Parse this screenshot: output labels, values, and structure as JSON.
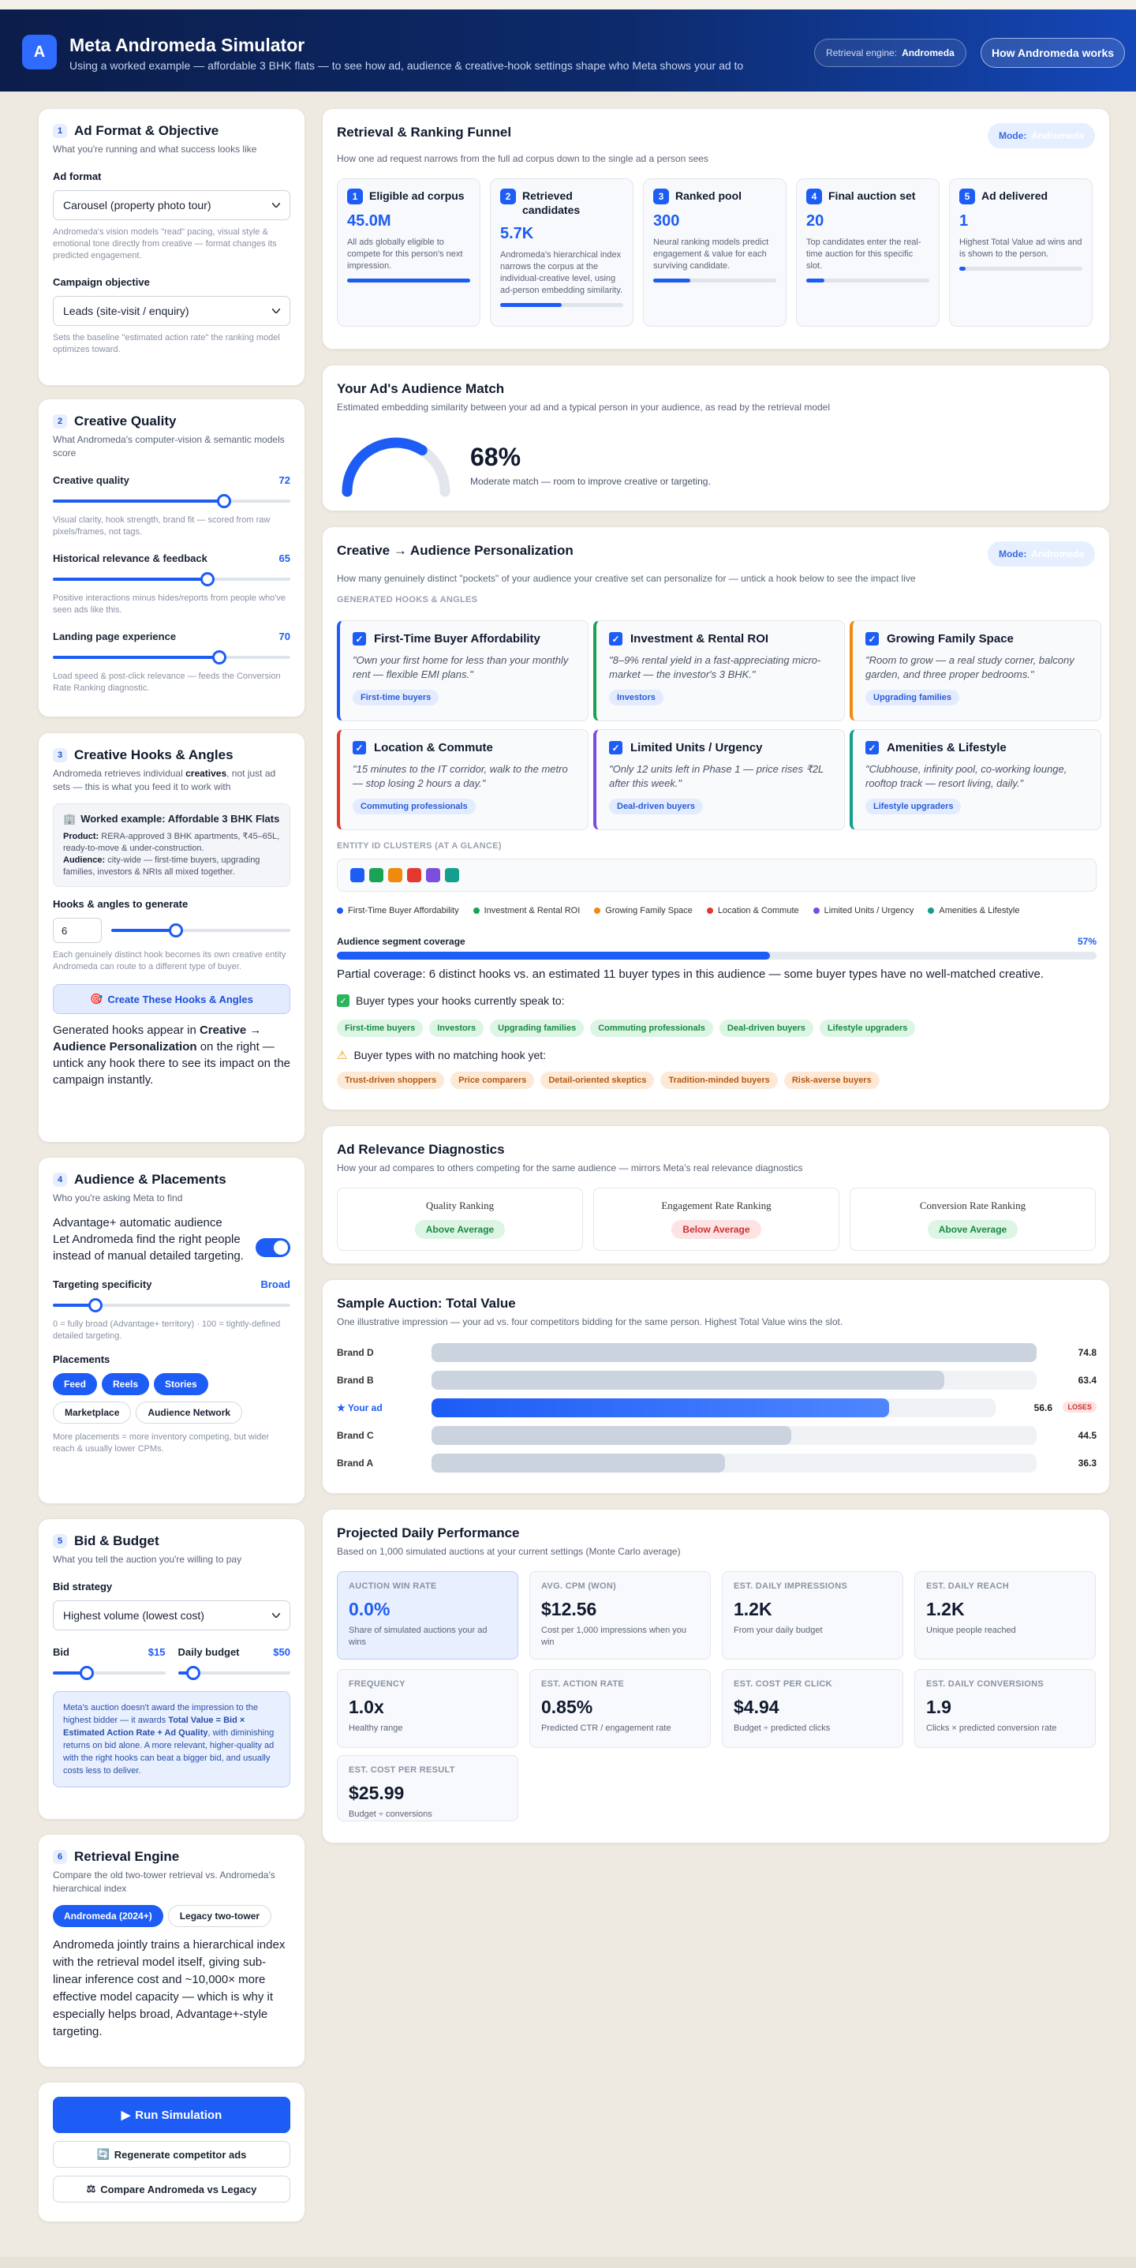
{
  "header": {
    "logo": "A",
    "title": "Meta Andromeda Simulator",
    "subtitle": "Using a worked example — affordable 3 BHK flats — to see how ad, audience & creative-hook settings shape who Meta shows your ad to",
    "engine_label": "Retrieval engine:",
    "engine_value": "Andromeda",
    "how_button": "How Andromeda works"
  },
  "s1": {
    "num": "1",
    "title": "Ad Format & Objective",
    "sub": "What you're running and what success looks like",
    "format_label": "Ad format",
    "format_value": "Carousel (property photo tour)",
    "format_hint": "Andromeda's vision models \"read\" pacing, visual style & emotional tone directly from creative — format changes its predicted engagement.",
    "obj_label": "Campaign objective",
    "obj_value": "Leads (site-visit / enquiry)",
    "obj_hint": "Sets the baseline \"estimated action rate\" the ranking model optimizes toward."
  },
  "s2": {
    "num": "2",
    "title": "Creative Quality",
    "sub": "What Andromeda's computer-vision & semantic models score",
    "cq_label": "Creative quality",
    "cq_value": "72",
    "cq_hint": "Visual clarity, hook strength, brand fit — scored from raw pixels/frames, not tags.",
    "hr_label": "Historical relevance & feedback",
    "hr_value": "65",
    "hr_hint": "Positive interactions minus hides/reports from people who've seen ads like this.",
    "lp_label": "Landing page experience",
    "lp_value": "70",
    "lp_hint": "Load speed & post-click relevance — feeds the Conversion Rate Ranking diagnostic."
  },
  "s3": {
    "num": "3",
    "title": "Creative Hooks & Angles",
    "sub_a": "Andromeda retrieves individual ",
    "sub_b": "creatives",
    "sub_c": ", not just ad sets — this is what you feed it to work with",
    "ex_title": "Worked example: Affordable 3 BHK Flats",
    "ex_prod_label": "Product:",
    "ex_prod": "RERA-approved 3 BHK apartments, ₹45–65L, ready-to-move & under-construction.",
    "ex_aud_label": "Audience:",
    "ex_aud": "city-wide — first-time buyers, upgrading families, investors & NRIs all mixed together.",
    "gen_label": "Hooks & angles to generate",
    "gen_value": "6",
    "gen_hint": "Each genuinely distinct hook becomes its own creative entity Andromeda can route to a different type of buyer.",
    "create_btn": "Create These Hooks & Angles",
    "note_a": "Generated hooks appear in ",
    "note_b": "Creative → Audience Personalization",
    "note_c": " on the right — untick any hook there to see its impact on the campaign instantly."
  },
  "s4": {
    "num": "4",
    "title": "Audience & Placements",
    "sub": "Who you're asking Meta to find",
    "adv_title": "Advantage+ automatic audience",
    "adv_desc": "Let Andromeda find the right people instead of manual detailed targeting.",
    "spec_label": "Targeting specificity",
    "spec_value": "Broad",
    "spec_hint": "0 = fully broad (Advantage+ territory) · 100 = tightly-defined detailed targeting.",
    "place_label": "Placements",
    "placements": [
      {
        "label": "Feed",
        "on": true
      },
      {
        "label": "Reels",
        "on": true
      },
      {
        "label": "Stories",
        "on": true
      },
      {
        "label": "Marketplace",
        "on": false
      },
      {
        "label": "Audience Network",
        "on": false
      }
    ],
    "place_hint": "More placements = more inventory competing, but wider reach & usually lower CPMs."
  },
  "s5": {
    "num": "5",
    "title": "Bid & Budget",
    "sub": "What you tell the auction you're willing to pay",
    "strat_label": "Bid strategy",
    "strat_value": "Highest volume (lowest cost)",
    "bid_label": "Bid",
    "bid_value": "$15",
    "budget_label": "Daily budget",
    "budget_value": "$50",
    "info_a": "Meta's auction doesn't award the impression to the highest bidder — it awards ",
    "info_b": "Total Value = Bid × Estimated Action Rate + Ad Quality",
    "info_c": ", with diminishing returns on bid alone. A more relevant, higher-quality ad with the right hooks can beat a bigger bid, and usually costs less to deliver."
  },
  "s6": {
    "num": "6",
    "title": "Retrieval Engine",
    "sub": "Compare the old two-tower retrieval vs. Andromeda's hierarchical index",
    "opt_on": "Andromeda (2024+)",
    "opt_off": "Legacy two-tower",
    "desc": "Andromeda jointly trains a hierarchical index with the retrieval model itself, giving sub-linear inference cost and ~10,000× more effective model capacity — which is why it especially helps broad, Advantage+-style targeting."
  },
  "actions": {
    "run": "Run Simulation",
    "regen": "Regenerate competitor ads",
    "compare": "Compare Andromeda vs Legacy"
  },
  "funnel": {
    "title": "Retrieval & Ranking Funnel",
    "sub": "How one ad request narrows from the full ad corpus down to the single ad a person sees",
    "mode_label": "Mode:",
    "mode_value": "Andromeda",
    "steps": [
      {
        "n": "1",
        "t": "Eligible ad corpus",
        "v": "45.0M",
        "d": "All ads globally eligible to compete for this person's next impression.",
        "p": 1.0
      },
      {
        "n": "2",
        "t": "Retrieved candidates",
        "v": "5.7K",
        "d": "Andromeda's hierarchical index narrows the corpus at the individual-creative level, using ad-person embedding similarity.",
        "p": 0.5
      },
      {
        "n": "3",
        "t": "Ranked pool",
        "v": "300",
        "d": "Neural ranking models predict engagement & value for each surviving candidate.",
        "p": 0.3
      },
      {
        "n": "4",
        "t": "Final auction set",
        "v": "20",
        "d": "Top candidates enter the real-time auction for this specific slot.",
        "p": 0.15
      },
      {
        "n": "5",
        "t": "Ad delivered",
        "v": "1",
        "d": "Highest Total Value ad wins and is shown to the person.",
        "p": 0.05
      }
    ]
  },
  "match": {
    "title": "Your Ad's Audience Match",
    "sub": "Estimated embedding similarity between your ad and a typical person in your audience, as read by the retrieval model",
    "value": "68%",
    "pct": 0.68,
    "desc": "Moderate match — room to improve creative or targeting."
  },
  "personal": {
    "title": "Creative → Audience Personalization",
    "sub": "How many genuinely distinct \"pockets\" of your audience your creative set can personalize for — untick a hook below to see the impact live",
    "mode_label": "Mode:",
    "mode_value": "Andromeda",
    "gen_heading": "GENERATED HOOKS & ANGLES",
    "hooks": [
      {
        "t": "First-Time Buyer Affordability",
        "q": "\"Own your first home for less than your monthly rent — flexible EMI plans.\"",
        "tag": "First-time buyers",
        "color": "#1d5cf5"
      },
      {
        "t": "Investment & Rental ROI",
        "q": "\"8–9% rental yield in a fast-appreciating micro-market — the investor's 3 BHK.\"",
        "tag": "Investors",
        "color": "#1aa354"
      },
      {
        "t": "Growing Family Space",
        "q": "\"Room to grow — a real study corner, balcony garden, and three proper bedrooms.\"",
        "tag": "Upgrading families",
        "color": "#f08a0c"
      },
      {
        "t": "Location & Commute",
        "q": "\"15 minutes to the IT corridor, walk to the metro — stop losing 2 hours a day.\"",
        "tag": "Commuting professionals",
        "color": "#e5382f"
      },
      {
        "t": "Limited Units / Urgency",
        "q": "\"Only 12 units left in Phase 1 — price rises ₹2L after this week.\"",
        "tag": "Deal-driven buyers",
        "color": "#7c4ee0"
      },
      {
        "t": "Amenities & Lifestyle",
        "q": "\"Clubhouse, infinity pool, co-working lounge, rooftop track — resort living, daily.\"",
        "tag": "Lifestyle upgraders",
        "color": "#139e8e"
      }
    ],
    "cluster_heading": "ENTITY ID CLUSTERS (AT A GLANCE)",
    "legend": [
      "First-Time Buyer Affordability",
      "Investment & Rental ROI",
      "Growing Family Space",
      "Location & Commute",
      "Limited Units / Urgency",
      "Amenities & Lifestyle"
    ],
    "cov_label": "Audience segment coverage",
    "cov_value": "57%",
    "cov_pct": 0.57,
    "cov_text": "Partial coverage: 6 distinct hooks vs. an estimated 11 buyer types in this audience — some buyer types have no well-matched creative.",
    "speak_label": "Buyer types your hooks currently speak to:",
    "speak": [
      "First-time buyers",
      "Investors",
      "Upgrading families",
      "Commuting professionals",
      "Deal-driven buyers",
      "Lifestyle upgraders"
    ],
    "nomatch_label": "Buyer types with no matching hook yet:",
    "nomatch": [
      "Trust-driven shoppers",
      "Price comparers",
      "Detail-oriented skeptics",
      "Tradition-minded buyers",
      "Risk-averse buyers"
    ]
  },
  "relevance": {
    "title": "Ad Relevance Diagnostics",
    "sub": "How your ad compares to others competing for the same audience — mirrors Meta's real relevance diagnostics",
    "items": [
      {
        "h": "Quality Ranking",
        "b": "Above Average",
        "good": true
      },
      {
        "h": "Engagement Rate Ranking",
        "b": "Below Average",
        "good": false
      },
      {
        "h": "Conversion Rate Ranking",
        "b": "Above Average",
        "good": true
      }
    ]
  },
  "auction": {
    "title": "Sample Auction: Total Value",
    "sub": "One illustrative impression — your ad vs. four competitors bidding for the same person. Highest Total Value wins the slot.",
    "max": 74.8,
    "rows": [
      {
        "name": "Brand D",
        "value": 74.8,
        "you": false
      },
      {
        "name": "Brand B",
        "value": 63.4,
        "you": false
      },
      {
        "name": "★ Your ad",
        "value": 56.6,
        "you": true,
        "badge": "LOSES"
      },
      {
        "name": "Brand C",
        "value": 44.5,
        "you": false
      },
      {
        "name": "Brand A",
        "value": 36.3,
        "you": false
      }
    ]
  },
  "perf": {
    "title": "Projected Daily Performance",
    "sub": "Based on 1,000 simulated auctions at your current settings (Monte Carlo average)",
    "metrics": [
      {
        "l": "AUCTION WIN RATE",
        "v": "0.0%",
        "s": "Share of simulated auctions your ad wins",
        "hi": true
      },
      {
        "l": "AVG. CPM (WON)",
        "v": "$12.56",
        "s": "Cost per 1,000 impressions when you win"
      },
      {
        "l": "EST. DAILY IMPRESSIONS",
        "v": "1.2K",
        "s": "From your daily budget"
      },
      {
        "l": "EST. DAILY REACH",
        "v": "1.2K",
        "s": "Unique people reached"
      },
      {
        "l": "FREQUENCY",
        "v": "1.0x",
        "s": "Healthy range"
      },
      {
        "l": "EST. ACTION RATE",
        "v": "0.85%",
        "s": "Predicted CTR / engagement rate"
      },
      {
        "l": "EST. COST PER CLICK",
        "v": "$4.94",
        "s": "Budget ÷ predicted clicks"
      },
      {
        "l": "EST. DAILY CONVERSIONS",
        "v": "1.9",
        "s": "Clicks × predicted conversion rate"
      },
      {
        "l": "EST. COST PER RESULT",
        "v": "$25.99",
        "s": "Budget ÷ conversions"
      }
    ]
  }
}
